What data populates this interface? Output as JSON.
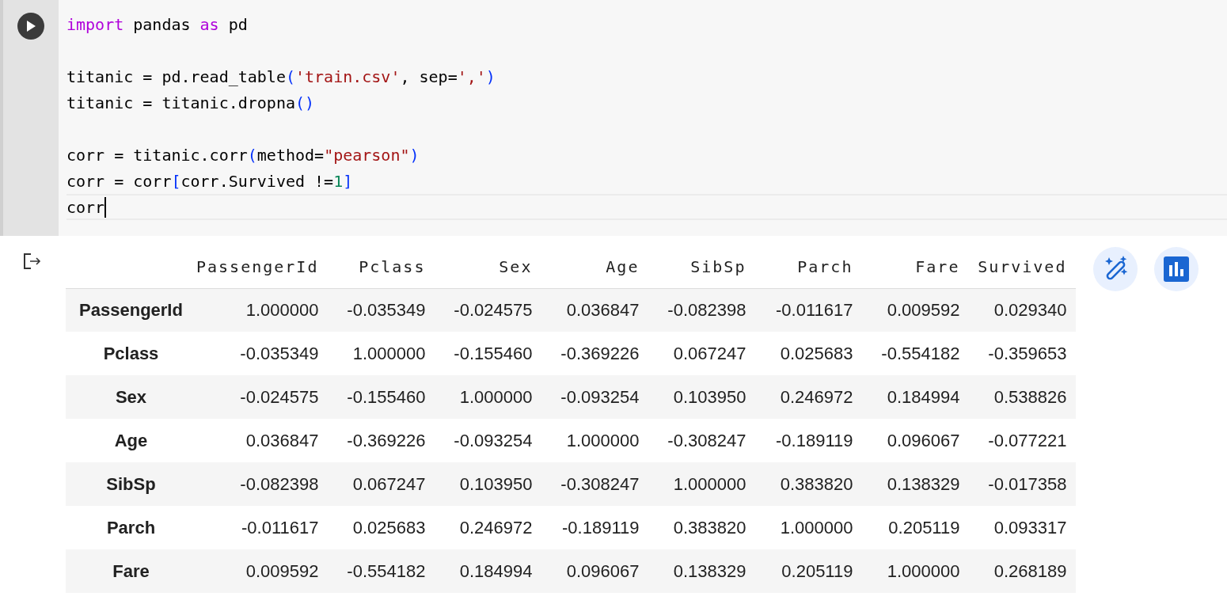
{
  "code_cell": {
    "lines": [
      {
        "kind": "code",
        "current": false,
        "tokens": [
          {
            "kind": "keyword",
            "text": "import"
          },
          {
            "kind": "plain",
            "text": " pandas "
          },
          {
            "kind": "keyword",
            "text": "as"
          },
          {
            "kind": "plain",
            "text": " pd"
          }
        ]
      },
      {
        "kind": "blank"
      },
      {
        "kind": "code",
        "current": false,
        "tokens": [
          {
            "kind": "plain",
            "text": "titanic = pd.read_table"
          },
          {
            "kind": "paren",
            "text": "("
          },
          {
            "kind": "string",
            "text": "'train.csv'"
          },
          {
            "kind": "plain",
            "text": ", sep="
          },
          {
            "kind": "string",
            "text": "','"
          },
          {
            "kind": "paren",
            "text": ")"
          }
        ]
      },
      {
        "kind": "code",
        "current": false,
        "tokens": [
          {
            "kind": "plain",
            "text": "titanic = titanic.dropna"
          },
          {
            "kind": "paren",
            "text": "()"
          }
        ]
      },
      {
        "kind": "blank"
      },
      {
        "kind": "code",
        "current": false,
        "tokens": [
          {
            "kind": "plain",
            "text": "corr = titanic.corr"
          },
          {
            "kind": "paren",
            "text": "("
          },
          {
            "kind": "plain",
            "text": "method="
          },
          {
            "kind": "string",
            "text": "\"pearson\""
          },
          {
            "kind": "paren",
            "text": ")"
          }
        ]
      },
      {
        "kind": "code",
        "current": false,
        "tokens": [
          {
            "kind": "plain",
            "text": "corr = corr"
          },
          {
            "kind": "paren",
            "text": "["
          },
          {
            "kind": "plain",
            "text": "corr.Survived !="
          },
          {
            "kind": "number",
            "text": "1"
          },
          {
            "kind": "paren",
            "text": "]"
          }
        ]
      },
      {
        "kind": "code",
        "current": true,
        "tokens": [
          {
            "kind": "plain",
            "text": "corr"
          }
        ]
      }
    ]
  },
  "table": {
    "columns": [
      "PassengerId",
      "Pclass",
      "Sex",
      "Age",
      "SibSp",
      "Parch",
      "Fare",
      "Survived"
    ],
    "rows": [
      {
        "label": "PassengerId",
        "cells": [
          "1.000000",
          "-0.035349",
          "-0.024575",
          "0.036847",
          "-0.082398",
          "-0.011617",
          "0.009592",
          "0.029340"
        ]
      },
      {
        "label": "Pclass",
        "cells": [
          "-0.035349",
          "1.000000",
          "-0.155460",
          "-0.369226",
          "0.067247",
          "0.025683",
          "-0.554182",
          "-0.359653"
        ]
      },
      {
        "label": "Sex",
        "cells": [
          "-0.024575",
          "-0.155460",
          "1.000000",
          "-0.093254",
          "0.103950",
          "0.246972",
          "0.184994",
          "0.538826"
        ]
      },
      {
        "label": "Age",
        "cells": [
          "0.036847",
          "-0.369226",
          "-0.093254",
          "1.000000",
          "-0.308247",
          "-0.189119",
          "0.096067",
          "-0.077221"
        ]
      },
      {
        "label": "SibSp",
        "cells": [
          "-0.082398",
          "0.067247",
          "0.103950",
          "-0.308247",
          "1.000000",
          "0.383820",
          "0.138329",
          "-0.017358"
        ]
      },
      {
        "label": "Parch",
        "cells": [
          "-0.011617",
          "0.025683",
          "0.246972",
          "-0.189119",
          "0.383820",
          "1.000000",
          "0.205119",
          "0.093317"
        ]
      },
      {
        "label": "Fare",
        "cells": [
          "0.009592",
          "-0.554182",
          "0.184994",
          "0.096067",
          "0.138329",
          "0.205119",
          "1.000000",
          "0.268189"
        ]
      }
    ]
  }
}
